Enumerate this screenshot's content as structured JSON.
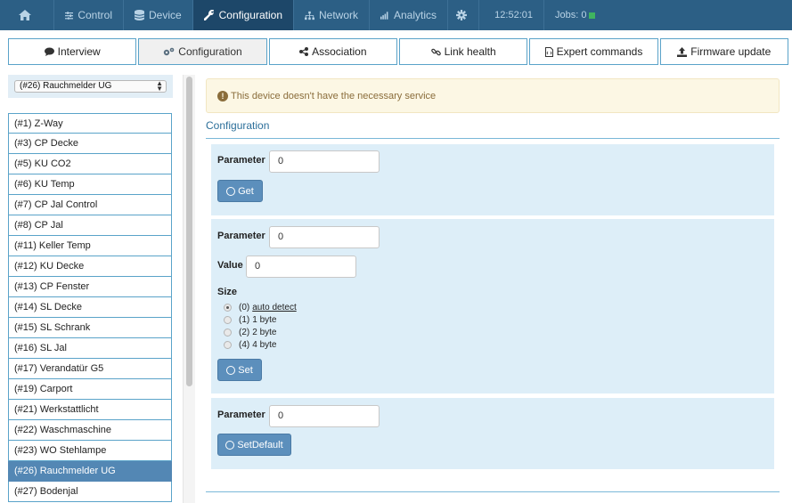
{
  "nav": {
    "items": [
      {
        "label": "Control",
        "icon": "sliders-icon"
      },
      {
        "label": "Device",
        "icon": "database-icon"
      },
      {
        "label": "Configuration",
        "icon": "wrench-icon"
      },
      {
        "label": "Network",
        "icon": "sitemap-icon"
      },
      {
        "label": "Analytics",
        "icon": "bar-chart-icon"
      }
    ],
    "active": "Configuration",
    "time": "12:52:01",
    "jobs": "Jobs: 0"
  },
  "tabs": [
    {
      "label": "Interview",
      "icon": "comment-icon"
    },
    {
      "label": "Configuration",
      "icon": "cogs-icon"
    },
    {
      "label": "Association",
      "icon": "share-icon"
    },
    {
      "label": "Link health",
      "icon": "link-icon"
    },
    {
      "label": "Expert commands",
      "icon": "file-code-icon"
    },
    {
      "label": "Firmware update",
      "icon": "upload-icon"
    }
  ],
  "sidebar": {
    "selected_device": "(#26) Rauchmelder UG",
    "devices": [
      "(#1) Z-Way",
      "(#3) CP Decke",
      "(#5) KU CO2",
      "(#6) KU Temp",
      "(#7) CP Jal Control",
      "(#8) CP Jal",
      "(#11) Keller Temp",
      "(#12) KU Decke",
      "(#13) CP Fenster",
      "(#14) SL Decke",
      "(#15) SL Schrank",
      "(#16) SL Jal",
      "(#17) Verandatür G5",
      "(#19) Carport",
      "(#21) Werkstattlicht",
      "(#22) Waschmaschine",
      "(#23) WO Stehlampe",
      "(#26) Rauchmelder UG",
      "(#27) Bodenjal"
    ]
  },
  "main": {
    "alert": "This device doesn't have the necessary service",
    "section_title": "Configuration",
    "get_panel": {
      "param_label": "Parameter",
      "param_value": "0",
      "button": "Get"
    },
    "set_panel": {
      "param_label": "Parameter",
      "param_value": "0",
      "value_label": "Value",
      "value_value": "0",
      "size_label": "Size",
      "size_options": [
        {
          "prefix": "(0)",
          "label": "auto detect",
          "checked": true
        },
        {
          "prefix": "(1)",
          "label": "1 byte",
          "checked": false
        },
        {
          "prefix": "(2)",
          "label": "2 byte",
          "checked": false
        },
        {
          "prefix": "(4)",
          "label": "4 byte",
          "checked": false
        }
      ],
      "button": "Set"
    },
    "default_panel": {
      "param_label": "Parameter",
      "param_value": "0",
      "button": "SetDefault"
    }
  }
}
